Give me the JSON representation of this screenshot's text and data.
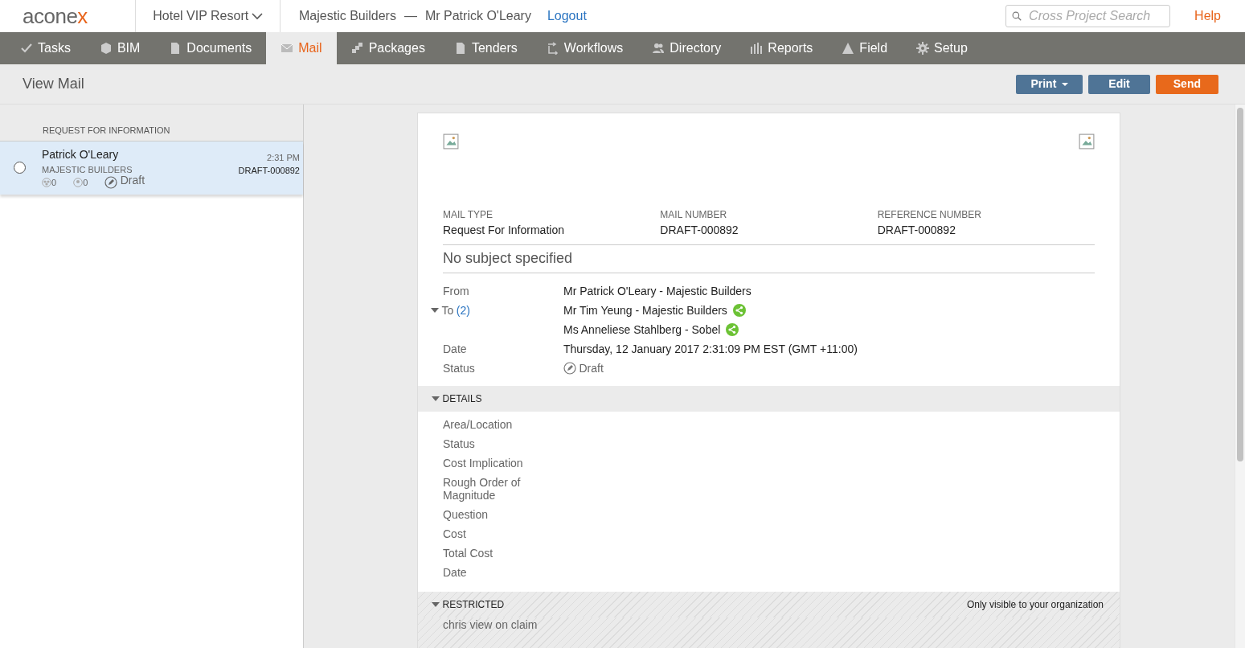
{
  "header": {
    "logo": "aconex",
    "project": "Hotel VIP Resort",
    "organization": "Majestic Builders",
    "separator": "—",
    "user": "Mr Patrick O'Leary",
    "logout": "Logout",
    "search": {
      "placeholder": "Cross Project Search"
    },
    "help": "Help"
  },
  "tabs": [
    {
      "label": "Tasks",
      "selected": false
    },
    {
      "label": "BIM",
      "selected": false
    },
    {
      "label": "Documents",
      "selected": false
    },
    {
      "label": "Mail",
      "selected": true
    },
    {
      "label": "Packages",
      "selected": false
    },
    {
      "label": "Tenders",
      "selected": false
    },
    {
      "label": "Workflows",
      "selected": false
    },
    {
      "label": "Directory",
      "selected": false
    },
    {
      "label": "Reports",
      "selected": false
    },
    {
      "label": "Field",
      "selected": false
    },
    {
      "label": "Setup",
      "selected": false
    }
  ],
  "page_title": "View Mail",
  "actions": [
    {
      "label": "Print",
      "kind": "dropdown"
    },
    {
      "label": "Edit",
      "kind": "secondary"
    },
    {
      "label": "Send",
      "kind": "primary"
    }
  ],
  "mail_list": {
    "group": "REQUEST FOR INFORMATION",
    "items": [
      {
        "sender": "Patrick O'Leary",
        "organization": "MAJESTIC BUILDERS",
        "time": "2:31 PM",
        "number": "DRAFT-000892",
        "group_count": "0",
        "person_count": "0",
        "status": "Draft",
        "selected": true,
        "checked": false
      }
    ]
  },
  "document": {
    "meta": [
      {
        "label": "MAIL TYPE",
        "value": "Request For Information"
      },
      {
        "label": "MAIL NUMBER",
        "value": "DRAFT-000892"
      },
      {
        "label": "REFERENCE NUMBER",
        "value": "DRAFT-000892"
      }
    ],
    "subject": "No subject specified",
    "from": {
      "label": "From",
      "value": "Mr Patrick O'Leary - Majestic Builders"
    },
    "to": {
      "label": "To",
      "count": "(2)",
      "expanded": true,
      "recipients": [
        "Mr Tim Yeung - Majestic Builders",
        "Ms Anneliese Stahlberg - Sobel"
      ]
    },
    "date": {
      "label": "Date",
      "value": "Thursday, 12 January 2017 2:31:09 PM EST (GMT +11:00)"
    },
    "status": {
      "label": "Status",
      "value": "Draft"
    },
    "details": {
      "title": "DETAILS",
      "expanded": true,
      "fields": [
        "Area/Location",
        "Status",
        "Cost Implication",
        "Rough Order of Magnitude",
        "Question",
        "Cost",
        "Total Cost",
        "Date"
      ]
    },
    "restricted": {
      "title": "RESTRICTED",
      "expanded": true,
      "note": "Only visible to your organization",
      "items": [
        "chris view on claim"
      ]
    }
  }
}
